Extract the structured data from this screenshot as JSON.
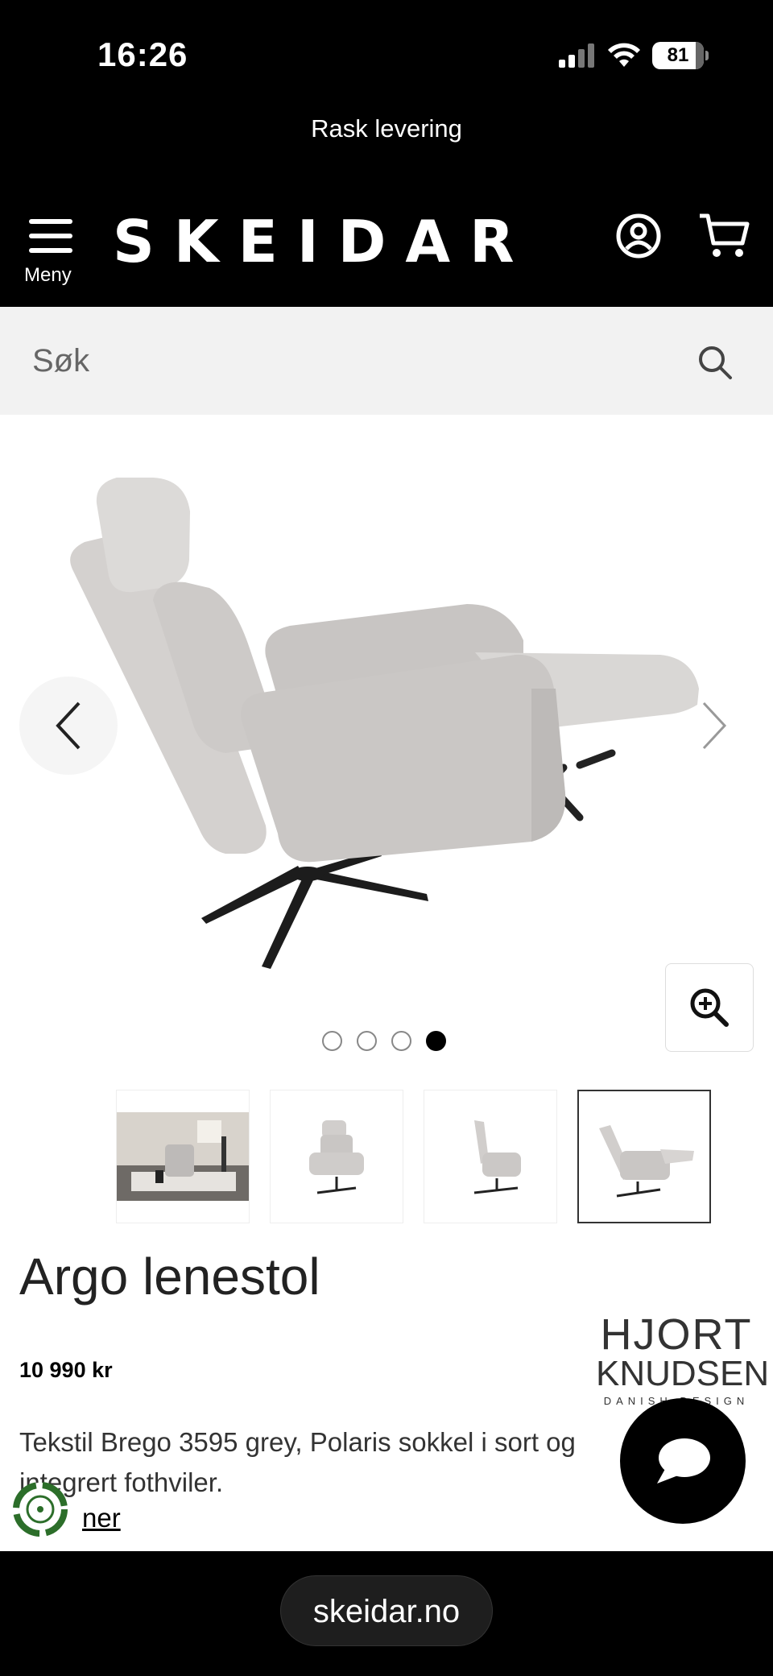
{
  "status_bar": {
    "time": "16:26",
    "battery": "81"
  },
  "promo": {
    "text": "Rask levering"
  },
  "header": {
    "logo": "SKEIDAR",
    "menu_label": "Meny"
  },
  "search": {
    "placeholder": "Søk"
  },
  "gallery": {
    "dots_total": 4,
    "active_dot": 4,
    "selected_thumbnail": 4
  },
  "product": {
    "title": "Argo lenestol",
    "price": "10 990 kr",
    "description": "Tekstil Brego 3595 grey, Polaris sokkel i sort og integrert fothviler.",
    "more_link": "ner",
    "brand": {
      "line1": "HJORT",
      "line2": "KNUDSEN",
      "line3": "DANISH DESIGN"
    }
  },
  "browser": {
    "url": "skeidar.no"
  }
}
